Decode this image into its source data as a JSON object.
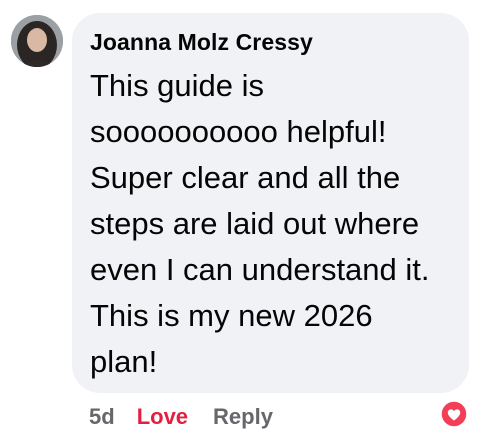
{
  "comment": {
    "author": "Joanna Molz Cressy",
    "text": "This guide is\nsoooooooooo helpful!\nSuper clear and all the\nsteps are laid out where\neven I can understand it.\nThis is my new 2026\nplan!",
    "timestamp": "5d",
    "reaction_label": "Love",
    "reply_label": "Reply",
    "reaction_icon": "heart-reaction-icon",
    "colors": {
      "bubble": "#f0f2f5",
      "love": "#e41e3f",
      "muted": "#65676b",
      "text": "#050505"
    }
  }
}
